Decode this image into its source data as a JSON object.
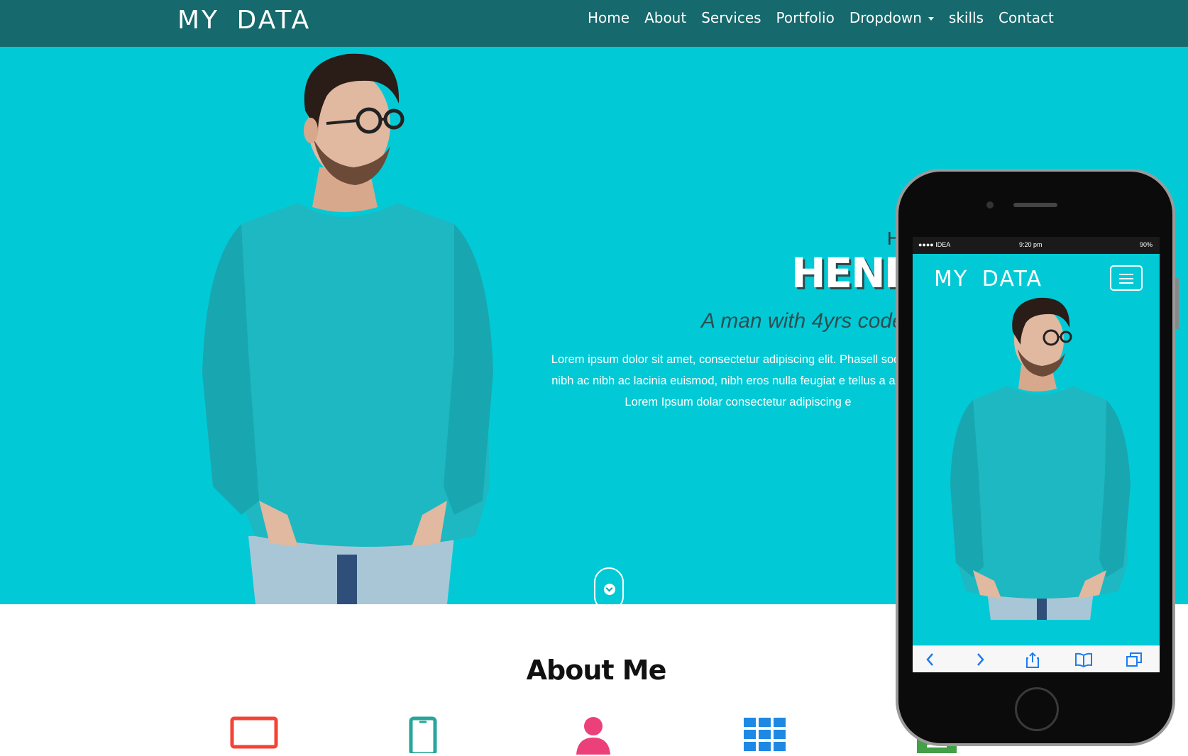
{
  "site": {
    "brand": "MY DATA"
  },
  "nav": {
    "items": [
      "Home",
      "About",
      "Services",
      "Portfolio",
      "Dropdown",
      "skills",
      "Contact"
    ]
  },
  "hero": {
    "greeting": "H",
    "name": "HENRY",
    "tagline": "A man with 4yrs code",
    "lorem": "Lorem ipsum dolor sit amet, consectetur adipiscing elit. Phasell sodales, nibh ac nibh ac lacinia euismod, nibh eros nulla feugiat e tellus a augue. Lorem Ipsum dolar consectetur adipiscing e",
    "scroll_icon": "chevron-down-icon"
  },
  "about": {
    "title": "About Me",
    "features": [
      {
        "icon": "laptop-icon",
        "color": "#f44336"
      },
      {
        "icon": "mobile-icon",
        "color": "#26a69a"
      },
      {
        "icon": "user-icon",
        "color": "#ec407a"
      },
      {
        "icon": "grid-icon",
        "color": "#1e88e5"
      },
      {
        "icon": "document-icon",
        "color": "#43a047"
      }
    ]
  },
  "phone": {
    "status_left": "●●●● IDEA",
    "status_time": "9:20 pm",
    "status_right": "90%",
    "brand": "MY DATA",
    "menu_icon": "hamburger-icon",
    "toolbar_icons": [
      "back-icon",
      "forward-icon",
      "share-icon",
      "bookmarks-icon",
      "tabs-icon"
    ]
  },
  "colors": {
    "nav_bg": "#16696c",
    "hero_bg": "#01cad6",
    "shirt": "#1db8c1",
    "ios_blue": "#1e7cf2"
  }
}
